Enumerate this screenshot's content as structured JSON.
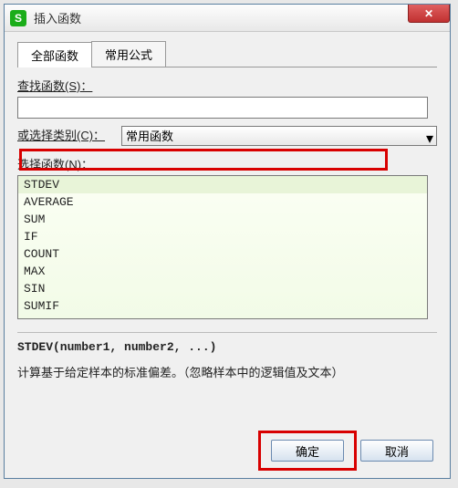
{
  "window": {
    "title": "插入函数",
    "app_icon_letter": "S"
  },
  "tabs": {
    "all": "全部函数",
    "common": "常用公式"
  },
  "labels": {
    "search": "查找函数(S)：",
    "category": "或选择类别(C)：",
    "select_func": "选择函数(N)："
  },
  "search": {
    "value": "",
    "placeholder": ""
  },
  "category": {
    "selected": "常用函数"
  },
  "functions": {
    "items": [
      "STDEV",
      "AVERAGE",
      "SUM",
      "IF",
      "COUNT",
      "MAX",
      "SIN",
      "SUMIF"
    ],
    "selected_index": 0
  },
  "detail": {
    "signature": "STDEV(number1, number2, ...)",
    "description": "计算基于给定样本的标准偏差。（忽略样本中的逻辑值及文本）"
  },
  "buttons": {
    "ok": "确定",
    "cancel": "取消"
  }
}
